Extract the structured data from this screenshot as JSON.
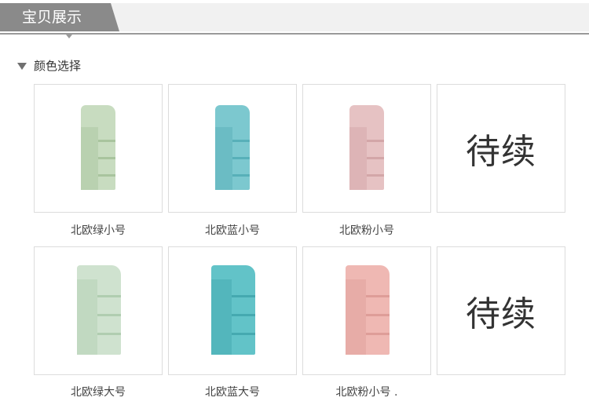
{
  "header": {
    "title": "宝贝展示"
  },
  "section": {
    "title": "颜色选择"
  },
  "colors": {
    "green": "#c8dcc0",
    "green_dark": "#a9c49e",
    "blue": "#7cc8cf",
    "blue_dark": "#58b0b9",
    "pink": "#e6c2c3",
    "pink_dark": "#d3a6a8",
    "pink2": "#efb8b3",
    "pink2_dark": "#de9d98",
    "greenL": "#cfe2cf",
    "greenL_dark": "#b0cdb0",
    "blueL": "#62c3c8",
    "blueL_dark": "#45a9b0"
  },
  "products": [
    {
      "caption": "北欧绿小号",
      "icon": "desk-organizer-green-small-icon"
    },
    {
      "caption": "北欧蓝小号",
      "icon": "desk-organizer-blue-small-icon"
    },
    {
      "caption": "北欧粉小号",
      "icon": "desk-organizer-pink-small-icon"
    },
    {
      "placeholder": "待续"
    },
    {
      "caption": "北欧绿大号",
      "icon": "desk-organizer-green-large-icon"
    },
    {
      "caption": "北欧蓝大号",
      "icon": "desk-organizer-blue-large-icon"
    },
    {
      "caption": "北欧粉小号 .",
      "icon": "desk-organizer-pink-large-icon"
    },
    {
      "placeholder": "待续"
    }
  ]
}
